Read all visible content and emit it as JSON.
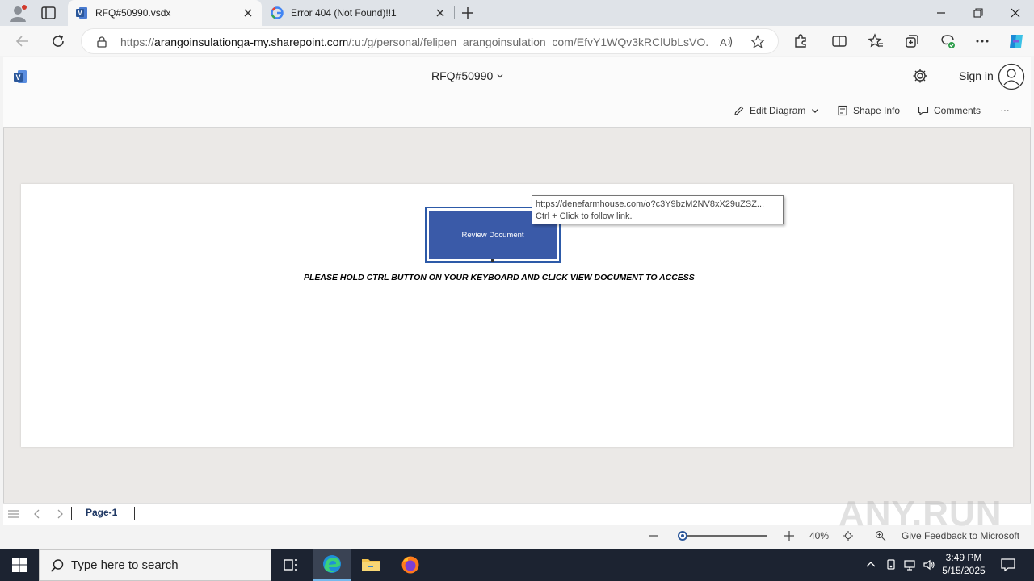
{
  "browser": {
    "tabs": [
      {
        "title": "RFQ#50990.vsdx",
        "favicon": "visio-icon",
        "active": true
      },
      {
        "title": "Error 404 (Not Found)!!1",
        "favicon": "google-icon",
        "active": false
      }
    ],
    "url": {
      "prefix": "https://",
      "host": "arangoinsulationga-my.sharepoint.com",
      "path": "/:u:/g/personal/felipen_arangoinsulation_com/EfvY1WQv3kRClUbLsVO..."
    }
  },
  "app": {
    "document_title": "RFQ#50990",
    "sign_in_label": "Sign in",
    "commands": {
      "edit_diagram": "Edit Diagram",
      "shape_info": "Shape Info",
      "comments": "Comments",
      "more": "···"
    }
  },
  "canvas": {
    "shape_label": "Review Document",
    "tooltip_url": "https://denefarmhouse.com/o?c3Y9bzM2NV8xX29uZSZ...",
    "tooltip_hint": "Ctrl + Click to follow link.",
    "instruction": "PLEASE HOLD CTRL BUTTON ON YOUR KEYBOARD AND CLICK VIEW DOCUMENT TO ACCESS"
  },
  "pagebar": {
    "page_tab": "Page-1"
  },
  "status": {
    "zoom_label": "40%",
    "zoom_fraction": 0.0,
    "feedback": "Give Feedback to Microsoft"
  },
  "watermark": "ANY.RUN",
  "taskbar": {
    "search_placeholder": "Type here to search",
    "time": "3:49 PM",
    "date": "5/15/2025"
  },
  "colors": {
    "shape_fill": "#3a5aa8",
    "shape_border": "#2d5aa8",
    "visio_brand": "#2b579a",
    "taskbar": "#1c2331"
  }
}
